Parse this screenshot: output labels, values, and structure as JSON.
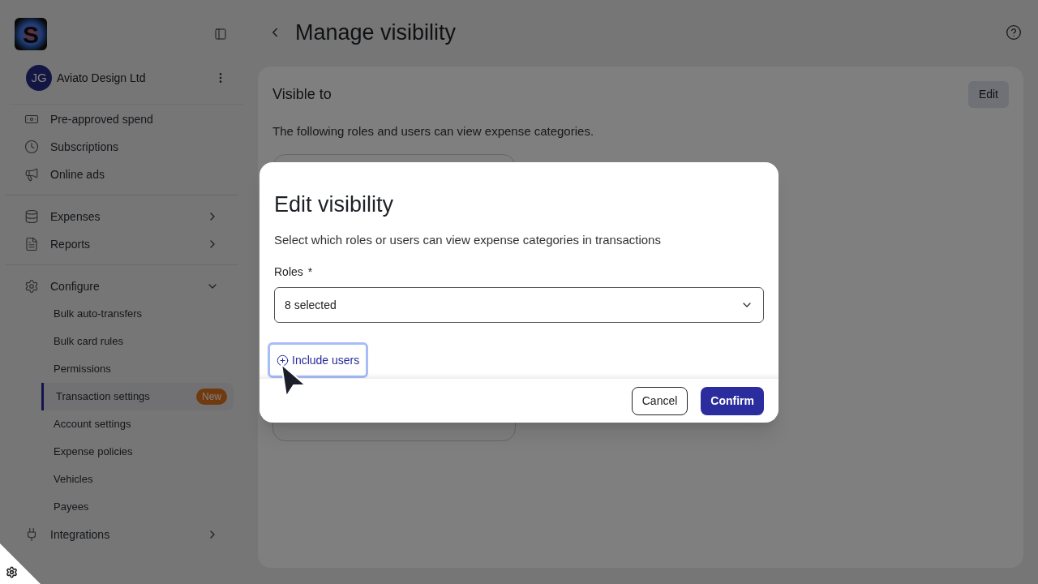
{
  "sidebar": {
    "logo_letter": "S",
    "org": {
      "initials": "JG",
      "name": "Aviato Design Ltd"
    },
    "groups": [
      [
        {
          "label": "Pre-approved spend"
        },
        {
          "label": "Subscriptions"
        },
        {
          "label": "Online ads"
        }
      ],
      [
        {
          "label": "Expenses",
          "expanded": false
        },
        {
          "label": "Reports",
          "expanded": false
        }
      ],
      [
        {
          "label": "Configure",
          "expanded": true,
          "children": [
            {
              "label": "Bulk auto-transfers",
              "selected": false
            },
            {
              "label": "Bulk card rules",
              "selected": false
            },
            {
              "label": "Permissions",
              "selected": false
            },
            {
              "label": "Transaction settings",
              "selected": true,
              "badge": "New"
            },
            {
              "label": "Account settings",
              "selected": false
            },
            {
              "label": "Expense policies",
              "selected": false
            },
            {
              "label": "Vehicles",
              "selected": false
            },
            {
              "label": "Payees",
              "selected": false
            }
          ]
        },
        {
          "label": "Integrations",
          "expanded": false
        }
      ]
    ]
  },
  "page": {
    "title": "Manage visibility",
    "section_title": "Visible to",
    "edit_button": "Edit",
    "description": "The following roles and users can view expense categories."
  },
  "dialog": {
    "title": "Edit visibility",
    "description": "Select which roles or users can view expense categories in transactions",
    "field": {
      "label": "Roles",
      "required_mark": "*",
      "value": "8 selected"
    },
    "include_button": "Include users",
    "buttons": {
      "cancel": "Cancel",
      "confirm": "Confirm"
    }
  }
}
